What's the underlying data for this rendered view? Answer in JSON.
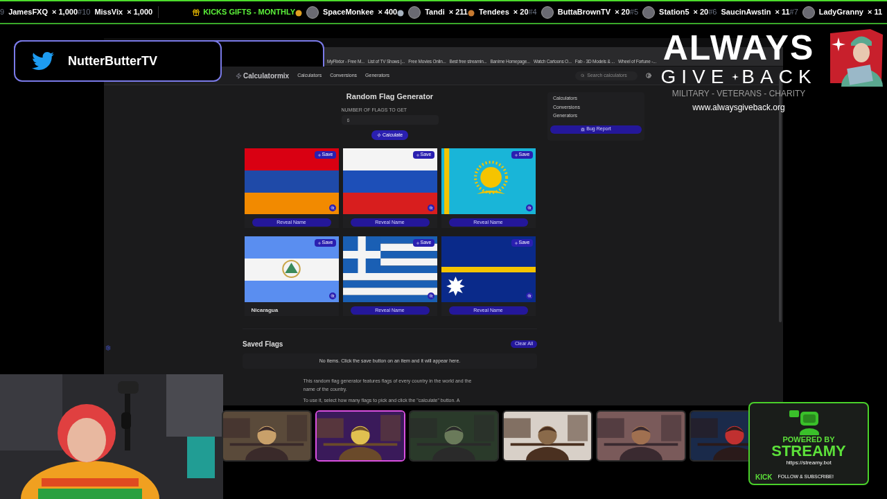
{
  "ticker": [
    {
      "kind": "entry",
      "rank": "9",
      "name": "JamesFXQ",
      "count": "× 1,000",
      "avatar": false
    },
    {
      "kind": "entry",
      "rank": "#10",
      "name": "MissVix",
      "count": "× 1,000",
      "avatar": false
    },
    {
      "kind": "header",
      "label": "KICKS GIFTS - MONTHLY"
    },
    {
      "kind": "entry",
      "color": "#e0a020",
      "name": "SpaceMonkee",
      "count": "× 400",
      "avatar": true
    },
    {
      "kind": "entry",
      "color": "#a8b4c0",
      "name": "Tandi",
      "count": "× 211",
      "avatar": true
    },
    {
      "kind": "entry",
      "color": "#c87a30",
      "name": "Tendees",
      "count": "× 20",
      "avatar": false
    },
    {
      "kind": "entry",
      "rank": "#4",
      "name": "ButtaBrownTV",
      "count": "× 20",
      "avatar": true
    },
    {
      "kind": "entry",
      "rank": "#5",
      "name": "Station5",
      "count": "× 20",
      "avatar": true
    },
    {
      "kind": "entry",
      "rank": "#6",
      "name": "SaucinAwstin",
      "count": "× 11",
      "avatar": false
    },
    {
      "kind": "entry",
      "rank": "#7",
      "name": "LadyGranny",
      "count": "× 11",
      "avatar": true
    }
  ],
  "social": {
    "handle": "NutterButterTV"
  },
  "browser": {
    "bookmarks": [
      "MyFlixtor - Free M...",
      "List of TV Shows |...",
      "Free Movies Onlin...",
      "Best free streamin...",
      "Banime Homepage...",
      "Watch Cartoons O...",
      "Fab - 3D Models & ...",
      "Wheel of Fortune -..."
    ]
  },
  "site": {
    "brand": "Calculatormix",
    "nav": [
      "Calculators",
      "Conversions",
      "Generators"
    ],
    "search_placeholder": "Search calculators"
  },
  "generator": {
    "title": "Random Flag Generator",
    "field_label": "NUMBER OF FLAGS TO GET",
    "field_value": "6",
    "calculate": "Calculate",
    "flags": [
      {
        "save": "Save",
        "revealed": false,
        "label": "Reveal Name"
      },
      {
        "save": "Save",
        "revealed": false,
        "label": "Reveal Name"
      },
      {
        "save": "Save",
        "revealed": false,
        "label": "Reveal Name"
      },
      {
        "save": "Save",
        "revealed": true,
        "label": "Nicaragua"
      },
      {
        "save": "Save",
        "revealed": false,
        "label": "Reveal Name"
      },
      {
        "save": "Save",
        "revealed": false,
        "label": "Reveal Name"
      }
    ]
  },
  "saved": {
    "title": "Saved Flags",
    "clear": "Clear All",
    "empty": "No items. Click the save button on an item and it will appear here.",
    "paragraphs": [
      "This random flag generator features flags of every country in the world and the name of the country.",
      "To use it, select how many flags to pick and click the \"calculate\" button. A"
    ]
  },
  "sidebar": {
    "links": [
      "Calculators",
      "Conversions",
      "Generators"
    ],
    "bug_report": "Bug Report"
  },
  "charity": {
    "line1": "ALWAYS",
    "line2": [
      "GIVE",
      "BACK"
    ],
    "tagline": "MILITARY - VETERANS - CHARITY",
    "url": "www.alwaysgiveback.org"
  },
  "streamy": {
    "powered": "POWERED BY",
    "name": "STREAMY",
    "url": "https://streamy.bot",
    "platform": "KICK",
    "cta": "FOLLOW & SUBSCRIBE!"
  },
  "main_camera": {
    "kind": "picture"
  },
  "webcams": [
    {
      "kind": "picture",
      "selected": false
    },
    {
      "kind": "picture",
      "selected": true
    },
    {
      "kind": "picture",
      "selected": false
    },
    {
      "kind": "picture",
      "selected": false
    },
    {
      "kind": "picture",
      "selected": false
    },
    {
      "kind": "picture",
      "selected": false
    }
  ]
}
